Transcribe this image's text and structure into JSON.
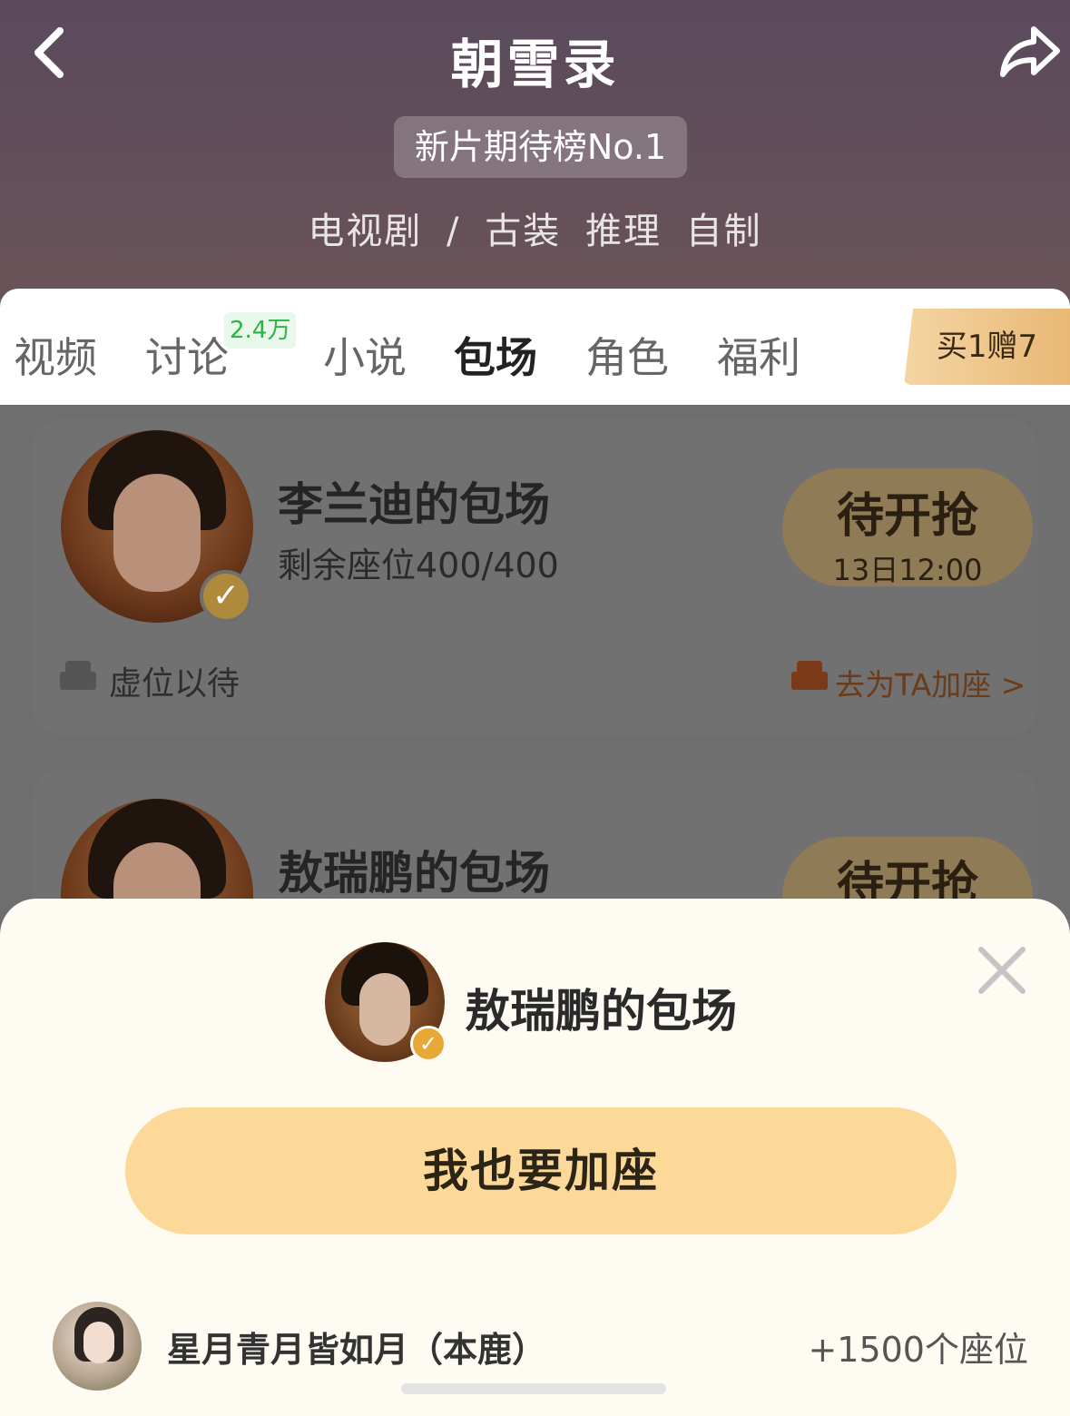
{
  "header": {
    "title": "朝雪录",
    "rank_badge": "新片期待榜No.1",
    "genre": [
      "电视剧",
      "/",
      "古装",
      "推理",
      "自制"
    ]
  },
  "tabs": {
    "items": [
      "视频",
      "讨论",
      "小说",
      "包场",
      "角色",
      "福利"
    ],
    "active": "包场",
    "discussion_count": "2.4万",
    "promo": "买1赠7"
  },
  "cards": [
    {
      "title": "李兰迪的包场",
      "seats": "剩余座位400/400",
      "status": "待开抢",
      "time": "13日12:00",
      "left_note": "虚位以待",
      "right_link": "去为TA加座 >"
    },
    {
      "title": "敖瑞鹏的包场",
      "status": "待开抢"
    }
  ],
  "sheet": {
    "title": "敖瑞鹏的包场",
    "cta": "我也要加座",
    "user_name": "星月青月皆如月（本鹿）",
    "user_seats": "+1500个座位"
  },
  "colors": {
    "accent": "#fdd999",
    "verify": "#e8a838",
    "tab_badge": "#2fb344"
  },
  "icons": [
    "back-icon",
    "share-icon",
    "close-icon",
    "seat-icon",
    "verified-icon"
  ]
}
